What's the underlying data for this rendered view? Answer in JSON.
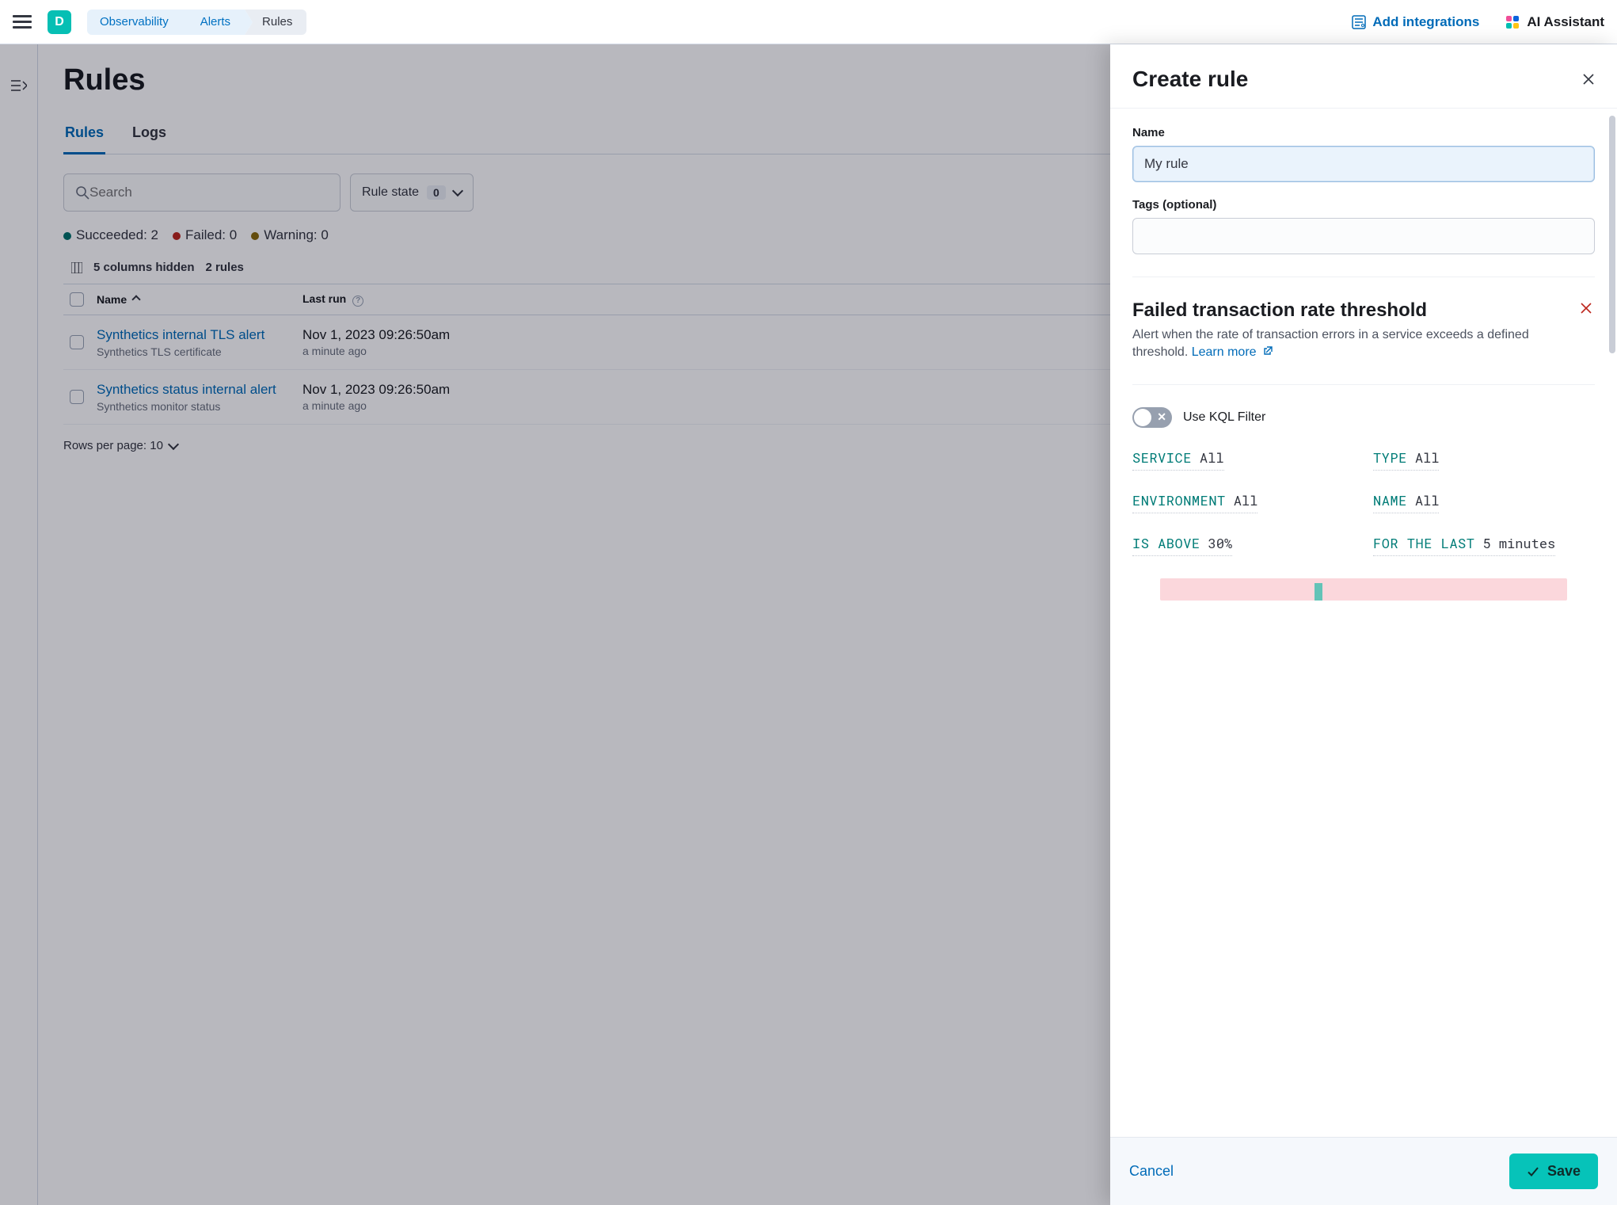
{
  "header": {
    "workspace_initial": "D",
    "breadcrumbs": [
      "Observability",
      "Alerts",
      "Rules"
    ],
    "add_integrations": "Add integrations",
    "ai_assistant": "AI Assistant"
  },
  "page": {
    "title": "Rules",
    "tabs": {
      "rules": "Rules",
      "logs": "Logs"
    },
    "search_placeholder": "Search",
    "rule_state": {
      "label": "Rule state",
      "count": "0"
    },
    "status": {
      "succeeded_label": "Succeeded:",
      "succeeded_count": "2",
      "failed_label": "Failed:",
      "failed_count": "0",
      "warning_label": "Warning:",
      "warning_count": "0"
    },
    "columns_hidden": "5 columns hidden",
    "rule_count": "2 rules",
    "columns": {
      "name": "Name",
      "last_run": "Last run"
    },
    "rows": [
      {
        "name": "Synthetics internal TLS alert",
        "subtitle": "Synthetics TLS certificate",
        "timestamp": "Nov 1, 2023 09:26:50am",
        "relative": "a minute ago"
      },
      {
        "name": "Synthetics status internal alert",
        "subtitle": "Synthetics monitor status",
        "timestamp": "Nov 1, 2023 09:26:50am",
        "relative": "a minute ago"
      }
    ],
    "rows_per_page": "Rows per page: 10"
  },
  "flyout": {
    "title": "Create rule",
    "name_label": "Name",
    "name_value": "My rule",
    "tags_label": "Tags (optional)",
    "rule_type": {
      "title": "Failed transaction rate threshold",
      "description": "Alert when the rate of transaction errors in a service exceeds a defined threshold.",
      "learn_more": "Learn more"
    },
    "kql_toggle_label": "Use KQL Filter",
    "scalars": {
      "service": {
        "k": "SERVICE",
        "v": "All"
      },
      "type": {
        "k": "TYPE",
        "v": "All"
      },
      "environment": {
        "k": "ENVIRONMENT",
        "v": "All"
      },
      "name": {
        "k": "NAME",
        "v": "All"
      },
      "is_above": {
        "k": "IS ABOVE",
        "v": "30%"
      },
      "for_last": {
        "k": "FOR THE LAST",
        "v": "5 minutes"
      }
    },
    "cancel": "Cancel",
    "save": "Save"
  }
}
